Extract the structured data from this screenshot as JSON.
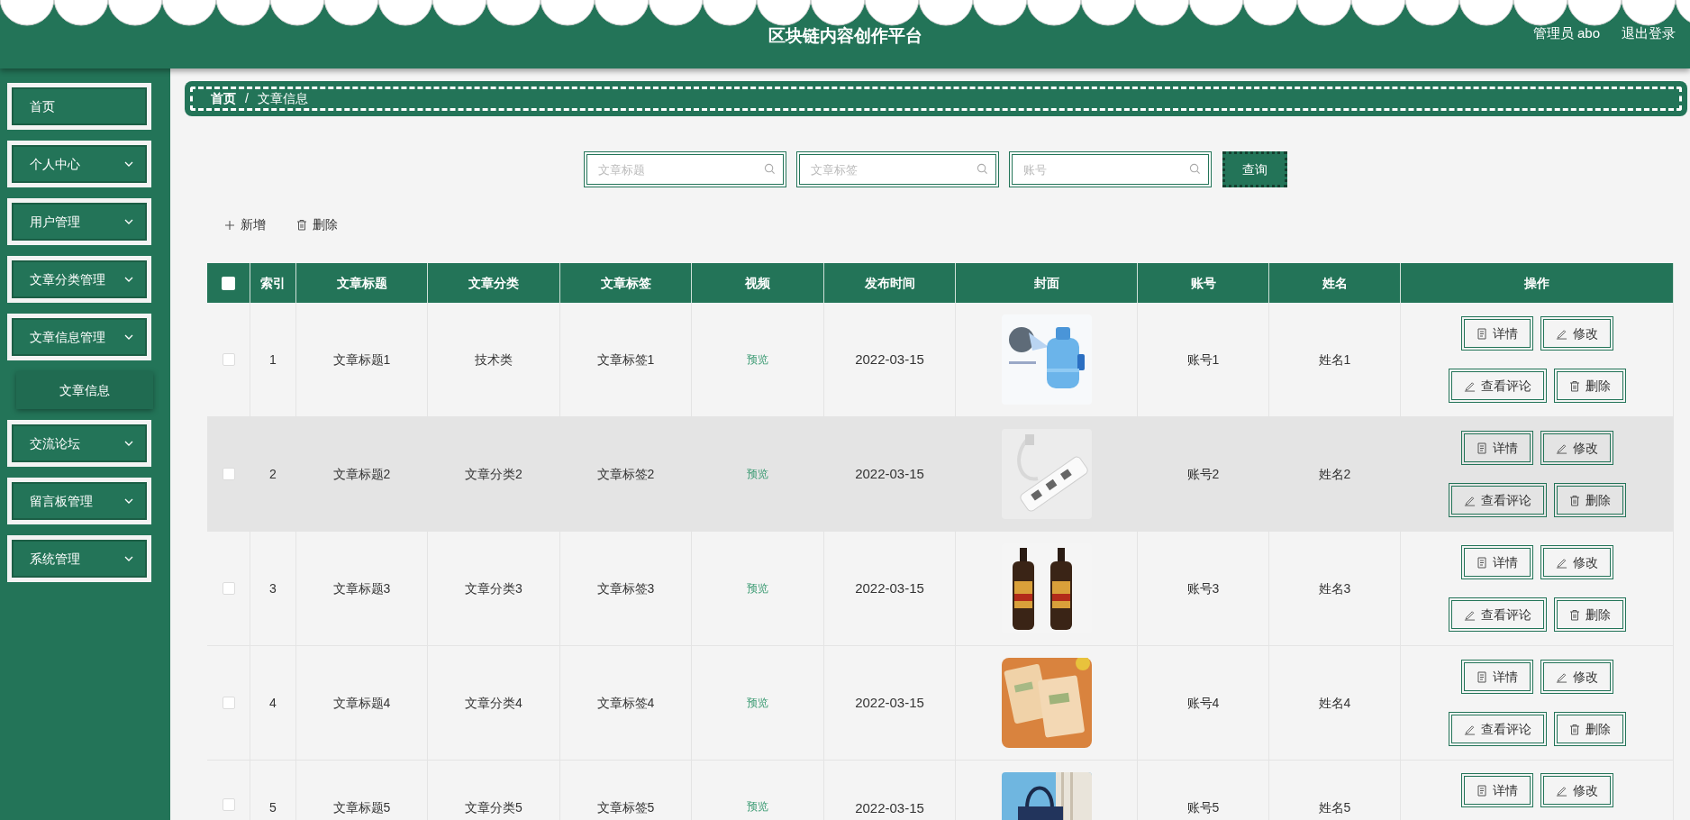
{
  "header": {
    "title": "区块链内容创作平台",
    "user": "管理员 abo",
    "logout": "退出登录"
  },
  "sidebar": {
    "items": [
      {
        "label": "首页",
        "expandable": false
      },
      {
        "label": "个人中心",
        "expandable": true
      },
      {
        "label": "用户管理",
        "expandable": true
      },
      {
        "label": "文章分类管理",
        "expandable": true
      },
      {
        "label": "文章信息管理",
        "expandable": true,
        "children": [
          {
            "label": "文章信息",
            "selected": true
          }
        ]
      },
      {
        "label": "交流论坛",
        "expandable": true
      },
      {
        "label": "留言板管理",
        "expandable": true
      },
      {
        "label": "系统管理",
        "expandable": true
      }
    ]
  },
  "breadcrumb": {
    "items": [
      "首页",
      "文章信息"
    ],
    "separator": "/"
  },
  "search": {
    "fields": [
      {
        "placeholder": "文章标题"
      },
      {
        "placeholder": "文章标签"
      },
      {
        "placeholder": "账号"
      }
    ],
    "button": "查询"
  },
  "actions": [
    {
      "kind": "add",
      "label": "新增"
    },
    {
      "kind": "delete",
      "label": "删除"
    }
  ],
  "table": {
    "header_checked": false,
    "columns": [
      "索引",
      "文章标题",
      "文章分类",
      "文章标签",
      "视频",
      "发布时间",
      "封面",
      "账号",
      "姓名",
      "操作"
    ],
    "rows": [
      {
        "index": "1",
        "title": "文章标题1",
        "category": "技术类",
        "tag": "文章标签1",
        "video": "预览",
        "date": "2022-03-15",
        "cover": {
          "kind": "picture"
        },
        "account": "账号1",
        "name": "姓名1",
        "checked": false,
        "highlighted": false,
        "actions": [
          {
            "kind": "detail",
            "label": "详情"
          },
          {
            "kind": "edit",
            "label": "修改"
          },
          {
            "kind": "comments",
            "label": "查看评论"
          },
          {
            "kind": "delete",
            "label": "删除"
          }
        ]
      },
      {
        "index": "2",
        "title": "文章标题2",
        "category": "文章分类2",
        "tag": "文章标签2",
        "video": "预览",
        "date": "2022-03-15",
        "cover": {
          "kind": "picture"
        },
        "account": "账号2",
        "name": "姓名2",
        "checked": false,
        "highlighted": true,
        "actions": [
          {
            "kind": "detail",
            "label": "详情"
          },
          {
            "kind": "edit",
            "label": "修改"
          },
          {
            "kind": "comments",
            "label": "查看评论"
          },
          {
            "kind": "delete",
            "label": "删除"
          }
        ]
      },
      {
        "index": "3",
        "title": "文章标题3",
        "category": "文章分类3",
        "tag": "文章标签3",
        "video": "预览",
        "date": "2022-03-15",
        "cover": {
          "kind": "picture"
        },
        "account": "账号3",
        "name": "姓名3",
        "checked": false,
        "highlighted": false,
        "actions": [
          {
            "kind": "detail",
            "label": "详情"
          },
          {
            "kind": "edit",
            "label": "修改"
          },
          {
            "kind": "comments",
            "label": "查看评论"
          },
          {
            "kind": "delete",
            "label": "删除"
          }
        ]
      },
      {
        "index": "4",
        "title": "文章标题4",
        "category": "文章分类4",
        "tag": "文章标签4",
        "video": "预览",
        "date": "2022-03-15",
        "cover": {
          "kind": "picture"
        },
        "account": "账号4",
        "name": "姓名4",
        "checked": false,
        "highlighted": false,
        "actions": [
          {
            "kind": "detail",
            "label": "详情"
          },
          {
            "kind": "edit",
            "label": "修改"
          },
          {
            "kind": "comments",
            "label": "查看评论"
          },
          {
            "kind": "delete",
            "label": "删除"
          }
        ]
      },
      {
        "index": "5",
        "title": "文章标题5",
        "category": "文章分类5",
        "tag": "文章标签5",
        "video": "预览",
        "date": "2022-03-15",
        "cover": {
          "kind": "picture"
        },
        "account": "账号5",
        "name": "姓名5",
        "checked": false,
        "highlighted": false,
        "actions": [
          {
            "kind": "detail",
            "label": "详情"
          },
          {
            "kind": "edit",
            "label": "修改"
          }
        ]
      }
    ]
  }
}
